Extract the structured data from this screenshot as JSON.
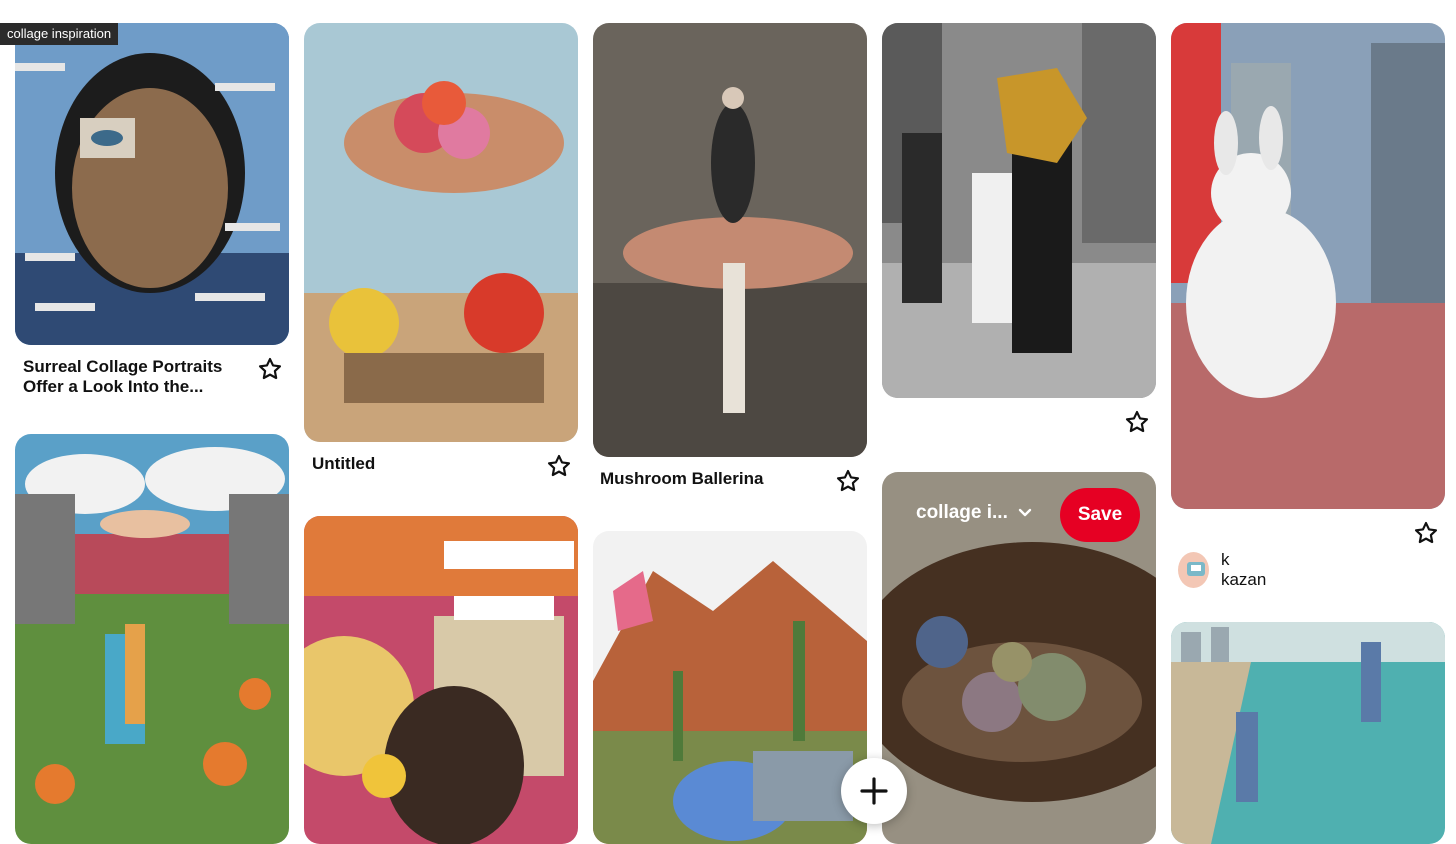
{
  "board_tag": "collage inspiration",
  "pins": {
    "p1": {
      "title": "Surreal Collage Portraits\nOffer a Look Into the..."
    },
    "p3": {
      "title": "Untitled"
    },
    "p5": {
      "title": "Mushroom Ballerina"
    },
    "p9": {
      "board_select": "collage i...",
      "save_label": "Save"
    },
    "p10": {
      "author": "k kazan"
    }
  },
  "actions": {
    "add_label": "+"
  },
  "colors": {
    "save_red": "#e60023",
    "overlay": "rgba(0,0,0,0.35)"
  }
}
